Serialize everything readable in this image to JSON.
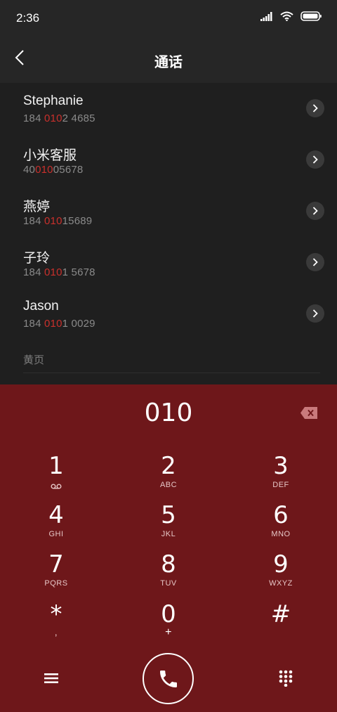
{
  "status_bar": {
    "time": "2:36",
    "icons": [
      "signal-icon",
      "wifi-icon",
      "battery-icon"
    ]
  },
  "header": {
    "title": "通话",
    "back_icon": "chevron-left-icon"
  },
  "results": [
    {
      "name": "Stephanie",
      "number_pre": "184 ",
      "number_hl": "010",
      "number_post": "2 4685"
    },
    {
      "name": "小米客服",
      "number_pre": "40",
      "number_hl": "010",
      "number_post": "05678"
    },
    {
      "name": "燕婷",
      "number_pre": "184 ",
      "number_hl": "010",
      "number_post": "15689"
    },
    {
      "name": "子玲",
      "number_pre": "184 ",
      "number_hl": "010",
      "number_post": "1 5678"
    },
    {
      "name": "Jason",
      "number_pre": "184 ",
      "number_hl": "010",
      "number_post": "1 0029"
    }
  ],
  "section_label": "黄页",
  "dialpad": {
    "input": "010",
    "keys": [
      {
        "digit": "1",
        "letters": ""
      },
      {
        "digit": "2",
        "letters": "ABC"
      },
      {
        "digit": "3",
        "letters": "DEF"
      },
      {
        "digit": "4",
        "letters": "GHI"
      },
      {
        "digit": "5",
        "letters": "JKL"
      },
      {
        "digit": "6",
        "letters": "MNO"
      },
      {
        "digit": "7",
        "letters": "PQRS"
      },
      {
        "digit": "8",
        "letters": "TUV"
      },
      {
        "digit": "9",
        "letters": "WXYZ"
      },
      {
        "digit": "*",
        "letters": ","
      },
      {
        "digit": "0",
        "letters": "+"
      },
      {
        "digit": "#",
        "letters": ""
      }
    ]
  },
  "colors": {
    "dialpad_bg": "#6e171a",
    "highlight": "#c9302c",
    "list_bg": "#1f1f1f",
    "header_bg": "#262626"
  }
}
